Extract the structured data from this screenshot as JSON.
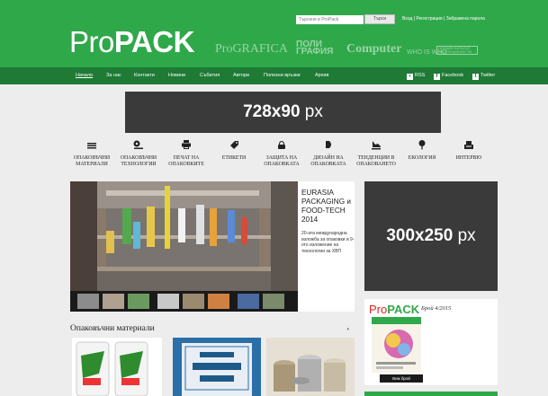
{
  "header": {
    "search_placeholder": "Търсене в ProPack",
    "search_button": "Търси",
    "top_links": [
      "Вход",
      "Регистрация",
      "Забравена парола"
    ],
    "logo_light": "Pro",
    "logo_bold": "PACK",
    "sister_sites": {
      "prografica": "ProGRAFICA",
      "poligrafia_1": "ПОЛИ",
      "poligrafia_2": "ГРАФИЯ",
      "computer": "Computer",
      "whoiswho": "WHO IS WHO",
      "whoiswho_box": "ОНЛАЙН КАТАЛОГ ОТ СПЕЦИАЛИСТИ"
    }
  },
  "nav": {
    "items": [
      "Начало",
      "За нас",
      "Контакти",
      "Новини",
      "Събития",
      "Автори",
      "Полезни връзки",
      "Архив"
    ],
    "rss": "RSS",
    "facebook": "Facebook",
    "twitter": "Twitter"
  },
  "ads": {
    "leaderboard_size": "728x90",
    "leaderboard_unit": "px",
    "rect_size": "300x250",
    "rect_unit": "px"
  },
  "categories": [
    {
      "line1": "ОПАКОВЪЧНИ",
      "line2": "МАТЕРИАЛИ",
      "icon": "stack-icon"
    },
    {
      "line1": "ОПАКОВЪЧНИ",
      "line2": "ТЕХНОЛОГИИ",
      "icon": "machine-icon"
    },
    {
      "line1": "ПЕЧАТ НА",
      "line2": "ОПАКОВКИТЕ",
      "icon": "printer-icon"
    },
    {
      "line1": "ЕТИКЕТИ",
      "line2": "",
      "icon": "tag-icon"
    },
    {
      "line1": "ЗАЩИТА НА",
      "line2": "ОПАКОВКАТА",
      "icon": "lock-icon"
    },
    {
      "line1": "ДИЗАЙН НА",
      "line2": "ОПАКОВКАТА",
      "icon": "design-icon"
    },
    {
      "line1": "ТЕНДЕНЦИИ В",
      "line2": "ОПАКОВАНЕТО",
      "icon": "trend-icon"
    },
    {
      "line1": "ЕКОЛОГИЯ",
      "line2": "",
      "icon": "leaf-icon"
    },
    {
      "line1": "ИНТЕРВЮ",
      "line2": "",
      "icon": "interview-icon"
    }
  ],
  "featured": {
    "title": "EURASIA PACKAGING и FOOD-TECH 2014",
    "description": "20-ата международна изложба за опаковки и 9-ото изложение на технологии за ХВП"
  },
  "magazine": {
    "logo_pro": "Pro",
    "logo_pack": "PACK",
    "issue": "Брой 4/2015",
    "button": "Виж брой"
  },
  "section": {
    "heading": "Опаковъчни материали"
  },
  "colors": {
    "brand_green": "#2fa84a",
    "nav_green": "#1e7a35",
    "ad_gray": "#3a3a3a"
  }
}
